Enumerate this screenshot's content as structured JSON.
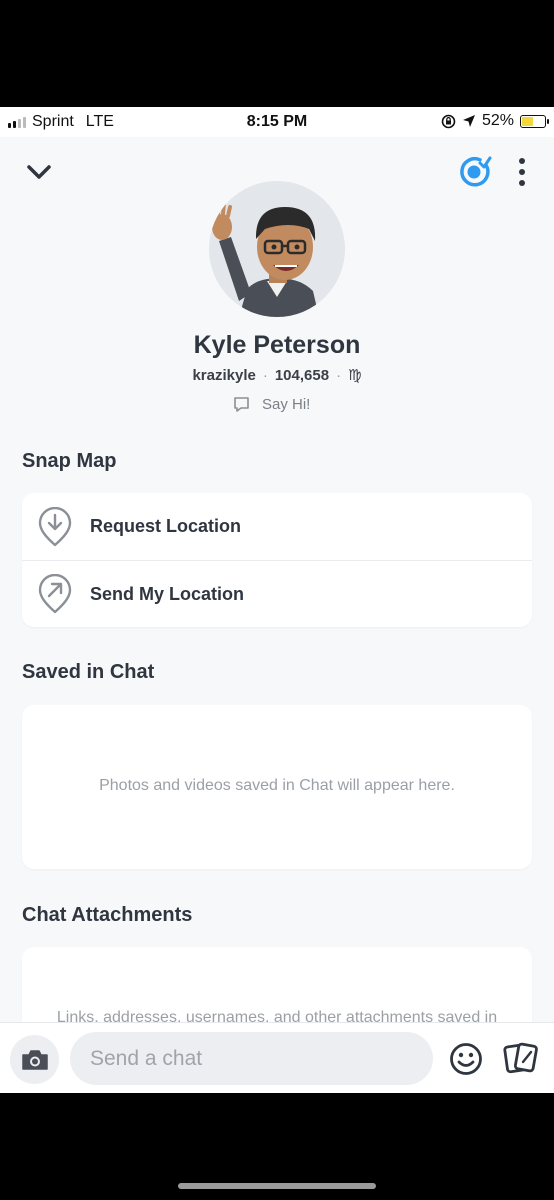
{
  "status_bar": {
    "carrier": "Sprint",
    "network": "LTE",
    "time": "8:15 PM",
    "battery": "52%",
    "battery_level": 0.52
  },
  "header": {
    "back_icon": "chevron-down-icon",
    "snap_icon": "snap-ring-icon",
    "more_icon": "more-vertical-icon",
    "accent_color": "#2e9bf0"
  },
  "profile": {
    "name": "Kyle Peterson",
    "username": "krazikyle",
    "score": "104,658",
    "zodiac": "♍",
    "say_hi": "Say Hi!"
  },
  "snap_map": {
    "title": "Snap Map",
    "items": [
      {
        "label": "Request Location",
        "icon": "location-request-icon"
      },
      {
        "label": "Send My Location",
        "icon": "location-send-icon"
      }
    ]
  },
  "saved_in_chat": {
    "title": "Saved in Chat",
    "empty_text": "Photos and videos saved in Chat will appear here."
  },
  "chat_attachments": {
    "title": "Chat Attachments",
    "empty_text": "Links, addresses, usernames, and other attachments saved in"
  },
  "composer": {
    "placeholder": "Send a chat",
    "camera_icon": "camera-icon",
    "emoji_icon": "emoji-icon",
    "cards_icon": "cards-icon"
  }
}
